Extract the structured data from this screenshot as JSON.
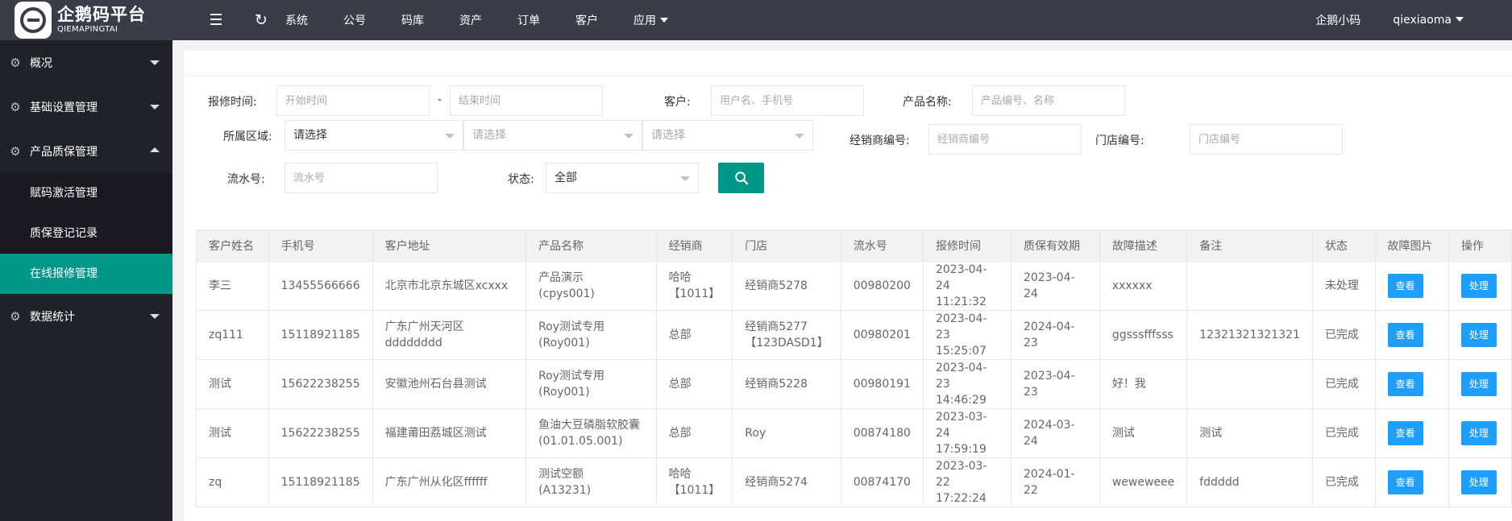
{
  "brand": {
    "name_cn": "企鹅码平台",
    "name_en": "QIEMAPINGTAI"
  },
  "topbar": {
    "icons": [
      "menu-fold-icon",
      "refresh-icon"
    ],
    "nav": [
      {
        "label": "系统"
      },
      {
        "label": "公号"
      },
      {
        "label": "码库"
      },
      {
        "label": "资产"
      },
      {
        "label": "订单"
      },
      {
        "label": "客户"
      },
      {
        "label": "应用",
        "dropdown": true
      }
    ],
    "right": {
      "mini_program": "企鹅小码",
      "user": "qiexiaoma"
    }
  },
  "sidebar": {
    "items": [
      {
        "label": "概况",
        "expanded": false
      },
      {
        "label": "基础设置管理",
        "expanded": false
      },
      {
        "label": "产品质保管理",
        "expanded": true,
        "children": [
          {
            "label": "赋码激活管理",
            "active": false
          },
          {
            "label": "质保登记记录",
            "active": false
          },
          {
            "label": "在线报修管理",
            "active": true
          }
        ]
      },
      {
        "label": "数据统计",
        "expanded": false
      }
    ]
  },
  "filters": {
    "repair_time_label": "报修时间:",
    "start_placeholder": "开始时间",
    "dash": "-",
    "end_placeholder": "结束时间",
    "customer_label": "客户:",
    "customer_placeholder": "用户名、手机号",
    "product_label": "产品名称:",
    "product_placeholder": "产品编号、名称",
    "region_label": "所属区域:",
    "region_province": "请选择",
    "region_city": "请选择",
    "region_district": "请选择",
    "dealer_label": "经销商编号:",
    "dealer_placeholder": "经销商编号",
    "store_label": "门店编号:",
    "store_placeholder": "门店编号",
    "serial_label": "流水号:",
    "serial_placeholder": "流水号",
    "status_label": "状态:",
    "status_value": "全部"
  },
  "table": {
    "columns": [
      "客户姓名",
      "手机号",
      "客户地址",
      "产品名称",
      "经销商",
      "门店",
      "流水号",
      "报修时间",
      "质保有效期",
      "故障描述",
      "备注",
      "状态",
      "故障图片",
      "操作"
    ],
    "view_label": "查看",
    "handle_label": "处理",
    "rows": [
      {
        "name": "李三",
        "phone": "13455566666",
        "address": "北京市北京东城区xcxxx",
        "product": "产品演示",
        "product_code": "(cpys001)",
        "dealer": "哈哈",
        "dealer_code": "【1011】",
        "store": "经销商5278",
        "store_code": "",
        "serial": "00980200",
        "repair_date": "2023-04-24",
        "repair_time": "11:21:32",
        "warranty": "2023-04-24",
        "fault": "xxxxxx",
        "remark": "",
        "status": "未处理"
      },
      {
        "name": "zq111",
        "phone": "15118921185",
        "address": "广东广州天河区dddddddd",
        "product": "Roy测试专用",
        "product_code": "(Roy001)",
        "dealer": "总部",
        "dealer_code": "",
        "store": "经销商5277",
        "store_code": "【123DASD1】",
        "serial": "00980201",
        "repair_date": "2023-04-23",
        "repair_time": "15:25:07",
        "warranty": "2024-04-23",
        "fault": "ggsssfffsss",
        "remark": "12321321321321",
        "status": "已完成"
      },
      {
        "name": "测试",
        "phone": "15622238255",
        "address": "安徽池州石台县测试",
        "product": "Roy测试专用",
        "product_code": "(Roy001)",
        "dealer": "总部",
        "dealer_code": "",
        "store": "经销商5228",
        "store_code": "",
        "serial": "00980191",
        "repair_date": "2023-04-23",
        "repair_time": "14:46:29",
        "warranty": "2023-04-23",
        "fault": "好！我",
        "remark": "",
        "status": "已完成"
      },
      {
        "name": "测试",
        "phone": "15622238255",
        "address": "福建莆田荔城区测试",
        "product": "鱼油大豆磷脂软胶囊",
        "product_code": "(01.01.05.001)",
        "dealer": "总部",
        "dealer_code": "",
        "store": "Roy",
        "store_code": "",
        "serial": "00874180",
        "repair_date": "2023-03-24",
        "repair_time": "17:59:19",
        "warranty": "2024-03-24",
        "fault": "测试",
        "remark": "测试",
        "status": "已完成"
      },
      {
        "name": "zq",
        "phone": "15118921185",
        "address": "广东广州从化区ffffff",
        "product": "测试空额",
        "product_code": "(A13231)",
        "dealer": "哈哈",
        "dealer_code": "【1011】",
        "store": "经销商5274",
        "store_code": "",
        "serial": "00874170",
        "repair_date": "2023-03-22",
        "repair_time": "17:22:24",
        "warranty": "2024-01-22",
        "fault": "weweweee",
        "remark": "fddddd",
        "status": "已完成"
      }
    ]
  }
}
